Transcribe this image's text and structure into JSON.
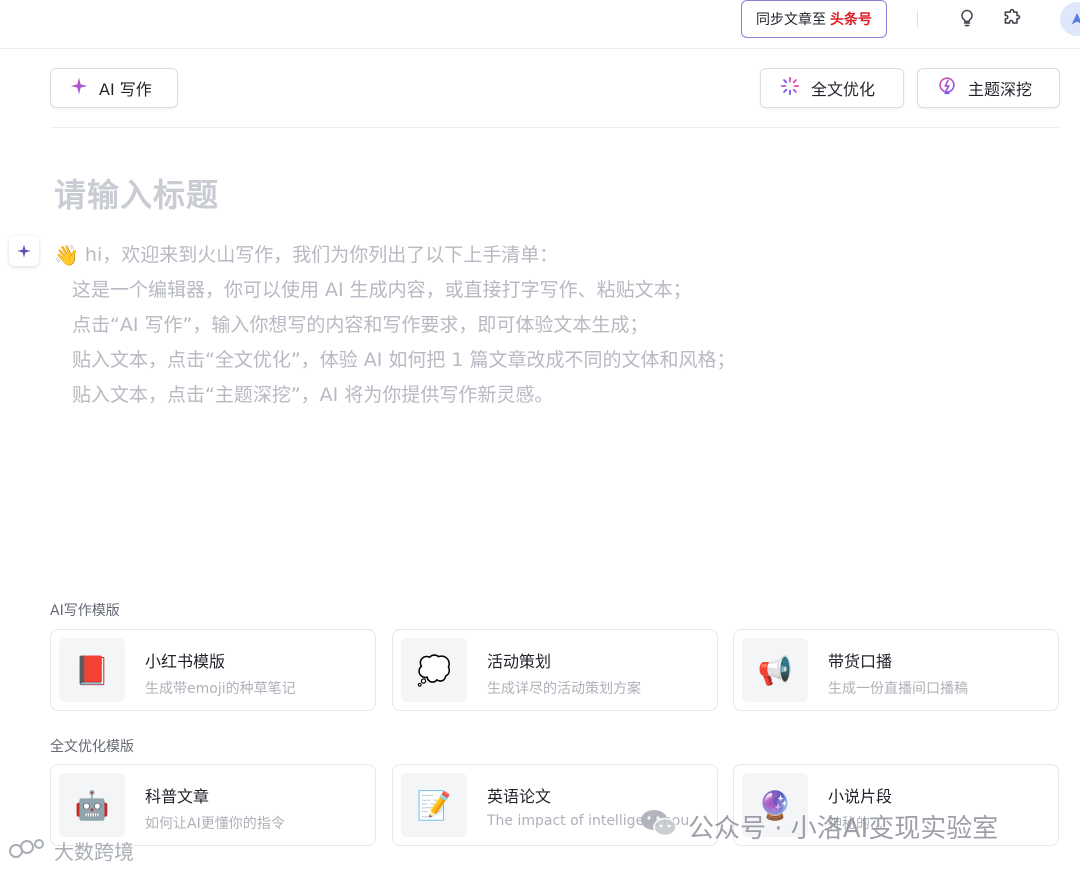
{
  "header": {
    "sync_label": "同步文章至",
    "sync_brand": "头条号",
    "icons": [
      "lightbulb-icon",
      "puzzle-icon",
      "avatar"
    ]
  },
  "toolbar": {
    "ai_write": "AI 写作",
    "full_optimize": "全文优化",
    "topic_dig": "主题深挖"
  },
  "editor": {
    "title_placeholder": "请输入标题",
    "intro_line": "hi，欢迎来到火山写作，我们为你列出了以下上手清单：",
    "checklist": [
      "这是一个编辑器，你可以使用 AI 生成内容，或直接打字写作、粘贴文本；",
      "点击“AI 写作”，输入你想写的内容和写作要求，即可体验文本生成；",
      "贴入文本，点击“全文优化”，体验 AI 如何把 1 篇文章改成不同的文体和风格；",
      "贴入文本，点击“主题深挖”，AI 将为你提供写作新灵感。"
    ]
  },
  "templates": {
    "ai_section": "AI写作模版",
    "ai_cards": [
      {
        "icon": "📕",
        "title": "小红书模版",
        "desc": "生成带emoji的种草笔记"
      },
      {
        "icon": "💭",
        "title": "活动策划",
        "desc": "生成详尽的活动策划方案"
      },
      {
        "icon": "📢",
        "title": "带货口播",
        "desc": "生成一份直播间口播稿"
      }
    ],
    "opt_section": "全文优化模版",
    "opt_cards": [
      {
        "icon": "🤖",
        "title": "科普文章",
        "desc": "如何让AI更懂你的指令"
      },
      {
        "icon": "📝",
        "title": "英语论文",
        "desc": "The impact of intelligent hou"
      },
      {
        "icon": "🔮",
        "title": "小说片段",
        "desc": "神秘的..."
      }
    ]
  },
  "watermark": {
    "right": "公众号 · 小洛AI变现实验室",
    "left": "大数跨境"
  },
  "colors": {
    "accent_purple": "#8f7fd8",
    "brand_red": "#e0212a",
    "placeholder_gray": "#c9ccd3"
  }
}
